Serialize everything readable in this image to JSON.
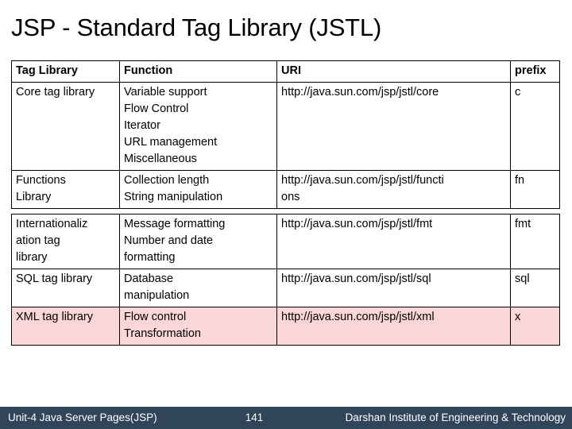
{
  "slide": {
    "title": "JSP - Standard Tag Library (JSTL)"
  },
  "table": {
    "headers": {
      "tag_library": "Tag Library",
      "function": "Function",
      "uri": "URI",
      "prefix": "prefix"
    },
    "rows": [
      {
        "library": "Core tag library",
        "functions": [
          "Variable support",
          "Flow Control",
          "Iterator",
          "URL management",
          "Miscellaneous"
        ],
        "uri": [
          "http://java.sun.com/jsp/jstl/core"
        ],
        "prefix": "c",
        "uri_align": "center",
        "highlight": false
      },
      {
        "library": "Functions Library",
        "library_lines": [
          "Functions",
          "Library"
        ],
        "functions": [
          "Collection length",
          "String manipulation"
        ],
        "uri": [
          "http://java.sun.com/jsp/jstl/functi",
          "ons"
        ],
        "prefix": "fn",
        "uri_align": "left",
        "highlight": false
      },
      {
        "library": "Internationalization tag library",
        "library_lines": [
          "Internationaliz",
          "ation tag",
          "library"
        ],
        "functions": [
          "Message formatting",
          "Number and date",
          "formatting"
        ],
        "uri": [
          "http://java.sun.com/jsp/jstl/fmt"
        ],
        "prefix": "fmt",
        "uri_align": "left",
        "highlight": false
      },
      {
        "library": "SQL tag library",
        "library_lines": [
          "SQL tag library"
        ],
        "functions": [
          "Database",
          "manipulation"
        ],
        "uri": [
          "http://java.sun.com/jsp/jstl/sql"
        ],
        "prefix": "sql",
        "uri_align": "left",
        "highlight": false
      },
      {
        "library": "XML tag library",
        "library_lines": [
          "XML tag library"
        ],
        "functions": [
          "Flow control",
          "Transformation"
        ],
        "uri": [
          "http://java.sun.com/jsp/jstl/xml"
        ],
        "prefix": "x",
        "uri_align": "left",
        "highlight": true
      }
    ]
  },
  "footer": {
    "left": "Unit-4 Java Server Pages(JSP)",
    "page": "141",
    "right": "Darshan Institute of Engineering & Technology",
    "background": "#31455A",
    "text_color": "#FFFFFF"
  },
  "colors": {
    "highlight_row": "#FAD6D6",
    "border": "#000000",
    "page_background": "#FFFFFF"
  }
}
